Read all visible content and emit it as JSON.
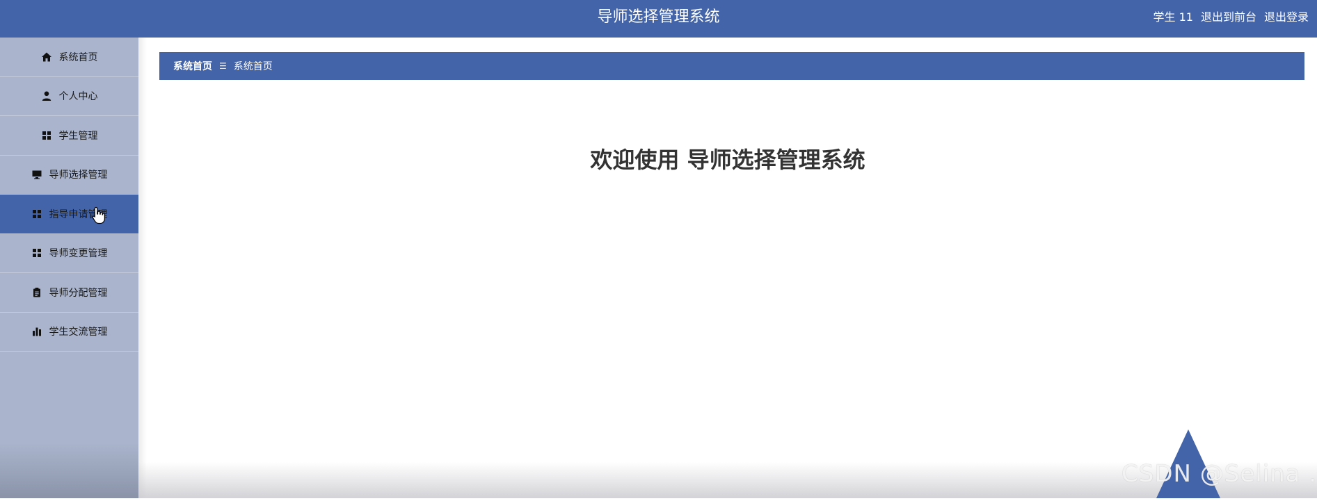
{
  "header": {
    "title": "导师选择管理系统",
    "user": "学生 11",
    "back_to_front": "退出到前台",
    "logout": "退出登录"
  },
  "sidebar": {
    "items": [
      {
        "label": "系统首页",
        "icon": "home-icon"
      },
      {
        "label": "个人中心",
        "icon": "user-icon"
      },
      {
        "label": "学生管理",
        "icon": "grid-icon"
      },
      {
        "label": "导师选择管理",
        "icon": "monitor-icon"
      },
      {
        "label": "指导申请管理",
        "icon": "grid-icon",
        "active": true
      },
      {
        "label": "导师变更管理",
        "icon": "grid-icon"
      },
      {
        "label": "导师分配管理",
        "icon": "clipboard-icon"
      },
      {
        "label": "学生交流管理",
        "icon": "bar-chart-icon"
      }
    ]
  },
  "breadcrumb": {
    "home": "系统首页",
    "separator": "☰",
    "current": "系统首页"
  },
  "main": {
    "welcome": "欢迎使用 导师选择管理系统"
  },
  "watermark": "CSDN @Selina .a",
  "colors": {
    "primary": "#4364a8",
    "sidebar_bg": "#aab5cd",
    "welcome_text": "#333333"
  }
}
